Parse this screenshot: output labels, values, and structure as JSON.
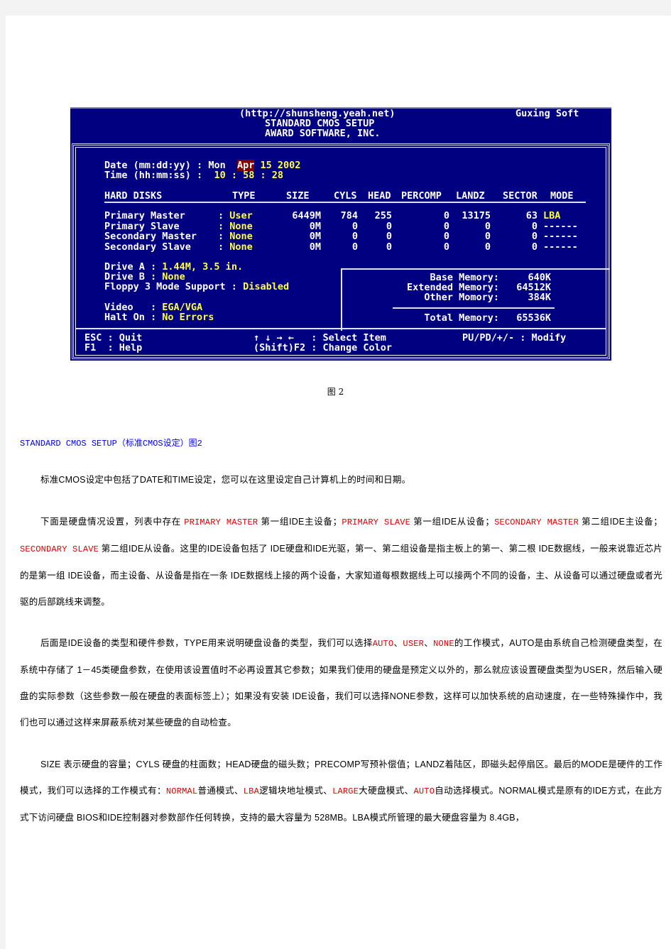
{
  "bios": {
    "header": {
      "url": "(http://shunsheng.yeah.net)",
      "brand": "Guxing Soft",
      "title": "STANDARD CMOS SETUP",
      "vendor": "AWARD SOFTWARE, INC."
    },
    "date": {
      "label": "Date (mm:dd:yy) : ",
      "weekday": "Mon",
      "month": "Apr",
      "rest": "15 2002"
    },
    "time": {
      "label": "Time (hh:mm:ss) : ",
      "value": "10 : 58 : 28"
    },
    "disk_headers": [
      "HARD DISKS",
      "TYPE",
      "SIZE",
      "CYLS",
      "HEAD",
      "PERCOMP",
      "LANDZ",
      "SECTOR",
      "MODE"
    ],
    "disks": [
      {
        "name": "Primary Master",
        "type": "User",
        "size": "6449M",
        "cyls": "784",
        "head": "255",
        "precomp": "0",
        "landz": "13175",
        "sector": "63",
        "mode": "LBA"
      },
      {
        "name": "Primary Slave",
        "type": "None",
        "size": "0M",
        "cyls": "0",
        "head": "0",
        "precomp": "0",
        "landz": "0",
        "sector": "0",
        "mode": "------"
      },
      {
        "name": "Secondary Master",
        "type": "None",
        "size": "0M",
        "cyls": "0",
        "head": "0",
        "precomp": "0",
        "landz": "0",
        "sector": "0",
        "mode": "------"
      },
      {
        "name": "Secondary Slave",
        "type": "None",
        "size": "0M",
        "cyls": "0",
        "head": "0",
        "precomp": "0",
        "landz": "0",
        "sector": "0",
        "mode": "------"
      }
    ],
    "drive_a": {
      "label": "Drive A : ",
      "value": "1.44M, 3.5 in."
    },
    "drive_b": {
      "label": "Drive B : ",
      "value": "None"
    },
    "floppy3": {
      "label": "Floppy 3 Mode Support : ",
      "value": "Disabled"
    },
    "video": {
      "label": "Video   : ",
      "value": "EGA/VGA"
    },
    "halt": {
      "label": "Halt On : ",
      "value": "No Errors"
    },
    "memory": {
      "base": {
        "label": "Base Memory:",
        "value": "640K"
      },
      "extended": {
        "label": "Extended Memory:",
        "value": "64512K"
      },
      "other": {
        "label": "Other Momory:",
        "value": "384K"
      },
      "total": {
        "label": "Total Memory:",
        "value": "65536K"
      }
    },
    "footer": {
      "esc": "ESC : Quit",
      "f1": "F1  : Help",
      "arrows": "↑ ↓ → ←   : Select Item",
      "shift_f2": "(Shift)F2 : Change Color",
      "modify": "PU/PD/+/- : Modify"
    }
  },
  "caption": "图 2",
  "subhead": "STANDARD CMOS SETUP（标准CMOS设定）图2",
  "paragraphs": {
    "p1": "标准CMOS设定中包括了DATE和TIME设定，您可以在这里设定自己计算机上的时间和日期。",
    "p2": [
      {
        "t": "下面是硬盘情况设置，列表中存在 "
      },
      {
        "t": "PRIMARY MASTER",
        "red": true
      },
      {
        "t": " 第一组IDE主设备；"
      },
      {
        "t": "PRIMARY SLAVE",
        "red": true
      },
      {
        "t": " 第一组IDE从设备；"
      },
      {
        "t": "SECONDARY MASTER",
        "red": true
      },
      {
        "t": " 第二组IDE主设备；"
      },
      {
        "t": "SECONDARY SLAVE",
        "red": true
      },
      {
        "t": " 第二组IDE从设备。这里的IDE设备包括了 IDE硬盘和IDE光驱，第一、第二组设备是指主板上的第一、第二根 IDE数据线，一般来说靠近芯片的是第一组 IDE设备，而主设备、从设备是指在一条 IDE数据线上接的两个设备，大家知道每根数据线上可以接两个不同的设备，主、从设备可以通过硬盘或者光驱的后部跳线来调整。"
      }
    ],
    "p3": [
      {
        "t": "后面是IDE设备的类型和硬件参数，TYPE用来说明硬盘设备的类型，我们可以选择"
      },
      {
        "t": "AUTO",
        "red": true
      },
      {
        "t": "、"
      },
      {
        "t": "USER",
        "red": true
      },
      {
        "t": "、"
      },
      {
        "t": "NONE",
        "red": true
      },
      {
        "t": "的工作模式，AUTO是由系统自己检测硬盘类型，在系统中存储了 1－45类硬盘参数，在使用该设置值时不必再设置其它参数；如果我们使用的硬盘是预定义以外的，那么就应该设置硬盘类型为USER，然后输入硬盘的实际参数（这些参数一般在硬盘的表面标签上）；如果没有安装 IDE设备，我们可以选择NONE参数，这样可以加快系统的启动速度，在一些特殊操作中，我们也可以通过这样来屏蔽系统对某些硬盘的自动检查。"
      }
    ],
    "p4": [
      {
        "t": "SIZE 表示硬盘的容量；CYLS 硬盘的柱面数；HEAD硬盘的磁头数；PRECOMP写预补偿值；LANDZ着陆区，即磁头起停扇区。最后的MODE是硬件的工作模式，我们可以选择的工作模式有："
      },
      {
        "t": "NORMAL",
        "red": true
      },
      {
        "t": "普通模式、"
      },
      {
        "t": "LBA",
        "red": true
      },
      {
        "t": "逻辑块地址模式、"
      },
      {
        "t": "LARGE",
        "red": true
      },
      {
        "t": "大硬盘模式、"
      },
      {
        "t": "AUTO",
        "red": true
      },
      {
        "t": "自动选择模式。NORMAL模式是原有的IDE方式，在此方式下访问硬盘 BIOS和IDE控制器对参数部作任何转换，支持的最大容量为 528MB。LBA模式所管理的最大硬盘容量为 8.4GB，"
      }
    ]
  },
  "colors": {
    "bios_bg": "#000080",
    "bios_value": "#ffff40",
    "bios_selected": "#800000",
    "subhead": "#0000ff",
    "highlight": "#e00000"
  }
}
